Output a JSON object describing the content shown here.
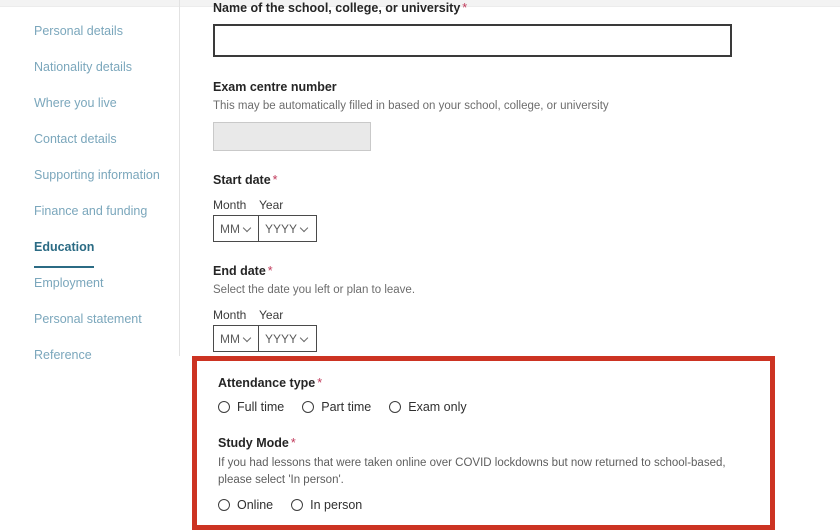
{
  "sidebar": {
    "items": [
      {
        "label": "Personal details",
        "active": false
      },
      {
        "label": "Nationality details",
        "active": false
      },
      {
        "label": "Where you live",
        "active": false
      },
      {
        "label": "Contact details",
        "active": false
      },
      {
        "label": "Supporting information",
        "active": false
      },
      {
        "label": "Finance and funding",
        "active": false
      },
      {
        "label": "Education",
        "active": true
      },
      {
        "label": "Employment",
        "active": false
      },
      {
        "label": "Personal statement",
        "active": false
      },
      {
        "label": "Reference",
        "active": false
      }
    ]
  },
  "form": {
    "school_name": {
      "label": "Name of the school, college, or university",
      "required_marker": "*",
      "value": "",
      "placeholder": ""
    },
    "exam_centre": {
      "label": "Exam centre number",
      "hint": "This may be automatically filled in based on your school, college, or university",
      "value": "",
      "placeholder": ""
    },
    "start_date": {
      "label": "Start date",
      "required_marker": "*",
      "month_label": "Month",
      "year_label": "Year",
      "month_value": "MM",
      "year_value": "YYYY"
    },
    "end_date": {
      "label": "End date",
      "required_marker": "*",
      "hint": "Select the date you left or plan to leave.",
      "month_label": "Month",
      "year_label": "Year",
      "month_value": "MM",
      "year_value": "YYYY"
    },
    "attendance_type": {
      "label": "Attendance type",
      "required_marker": "*",
      "options": [
        "Full time",
        "Part time",
        "Exam only"
      ]
    },
    "study_mode": {
      "label": "Study Mode",
      "required_marker": "*",
      "hint": "If you had lessons that were taken online over COVID lockdowns but now returned to school-based, please select 'In person'.",
      "options": [
        "Online",
        "In person"
      ]
    }
  },
  "colors": {
    "highlight_border": "#cc3322",
    "nav_link": "#7ba7bc",
    "nav_active": "#2b6b84",
    "required_asterisk": "#c0395a"
  }
}
